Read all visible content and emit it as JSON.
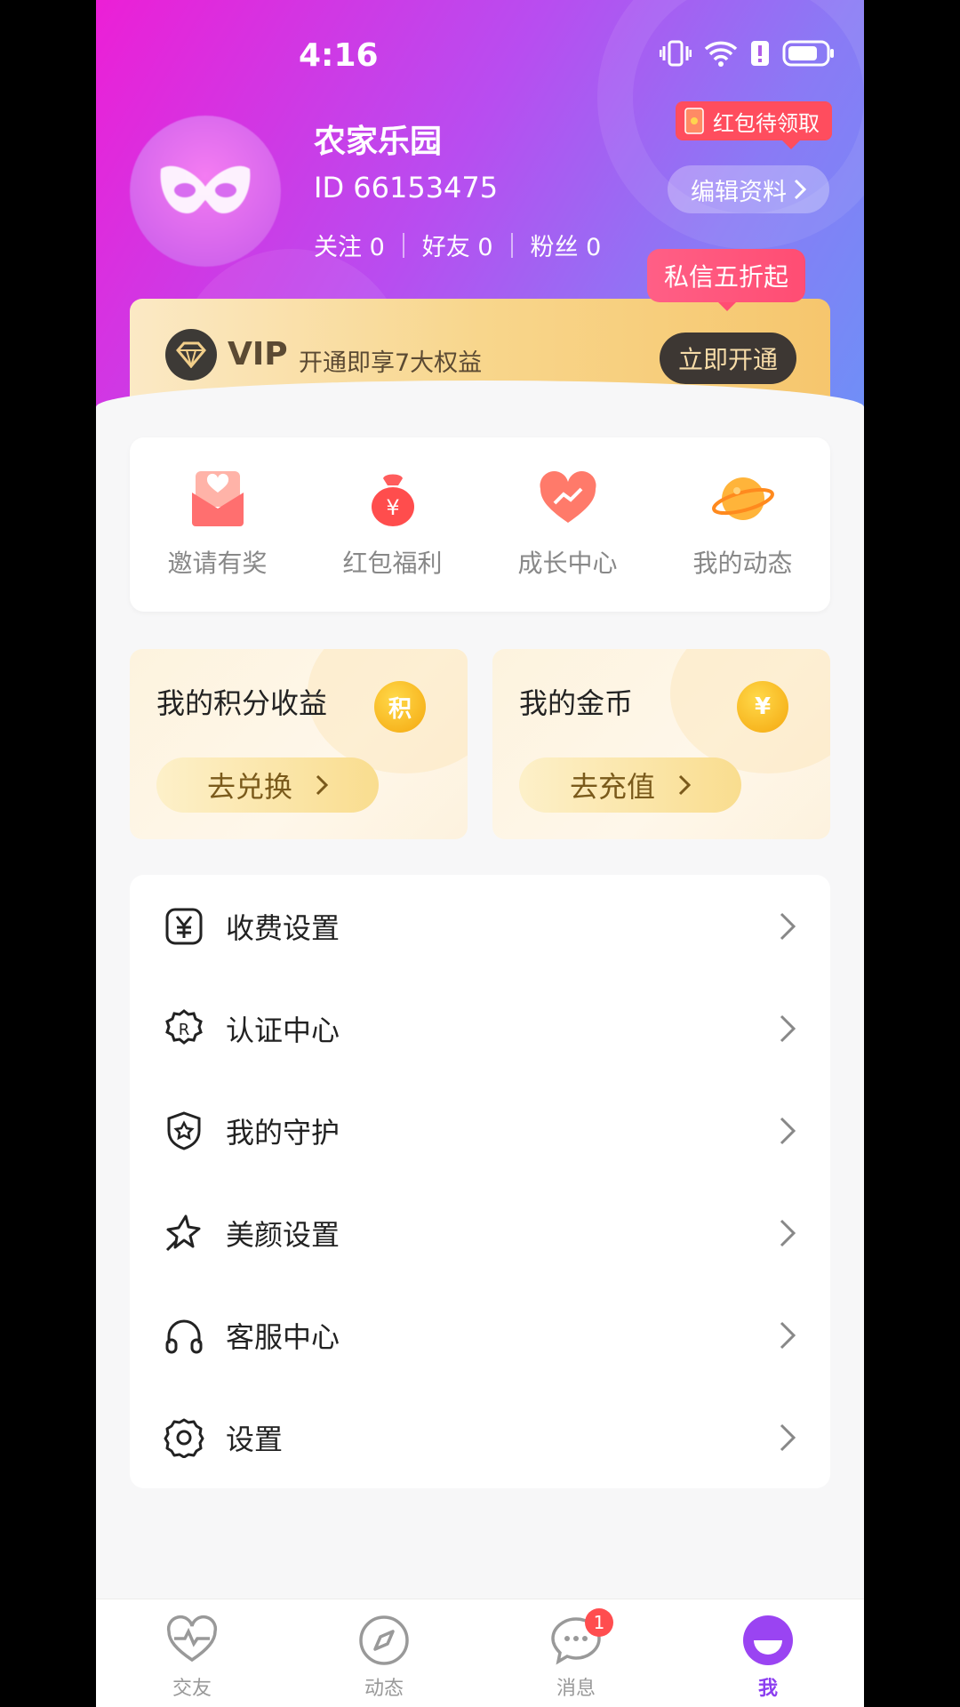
{
  "status": {
    "time": "4:16"
  },
  "profile": {
    "name": "农家乐园",
    "id_text": "ID 66153475",
    "follow": "关注 0",
    "friends": "好友 0",
    "fans": "粉丝 0",
    "redpack_badge": "红包待领取",
    "edit_label": "编辑资料",
    "dm_bubble": "私信五折起"
  },
  "vip": {
    "label": "VIP",
    "subtitle": "开通即享7大权益",
    "button": "立即开通"
  },
  "quick_actions": [
    {
      "label": "邀请有奖",
      "icon": "envelope-heart-icon"
    },
    {
      "label": "红包福利",
      "icon": "money-bag-icon"
    },
    {
      "label": "成长中心",
      "icon": "growth-heart-icon"
    },
    {
      "label": "我的动态",
      "icon": "planet-icon"
    }
  ],
  "wallet": {
    "points": {
      "title": "我的积分收益",
      "icon_text": "积",
      "button": "去兑换"
    },
    "coins": {
      "title": "我的金币",
      "icon_text": "¥",
      "button": "去充值"
    }
  },
  "menu": [
    {
      "label": "收费设置",
      "icon": "yen-box-icon"
    },
    {
      "label": "认证中心",
      "icon": "certified-badge-icon"
    },
    {
      "label": "我的守护",
      "icon": "shield-star-icon"
    },
    {
      "label": "美颜设置",
      "icon": "sparkle-star-icon"
    },
    {
      "label": "客服中心",
      "icon": "headphones-icon"
    },
    {
      "label": "设置",
      "icon": "gear-icon"
    }
  ],
  "tabs": [
    {
      "label": "交友",
      "icon": "heartbeat-icon"
    },
    {
      "label": "动态",
      "icon": "compass-icon"
    },
    {
      "label": "消息",
      "icon": "chat-bubble-icon",
      "badge": "1"
    },
    {
      "label": "我",
      "icon": "profile-face-icon"
    }
  ],
  "colors": {
    "accent": "#8c3ff0",
    "hero_start": "#ec1fd6",
    "hero_end": "#6f8ff7",
    "vip_gold": "#f8d68c",
    "badge_red": "#ff4d5e"
  }
}
